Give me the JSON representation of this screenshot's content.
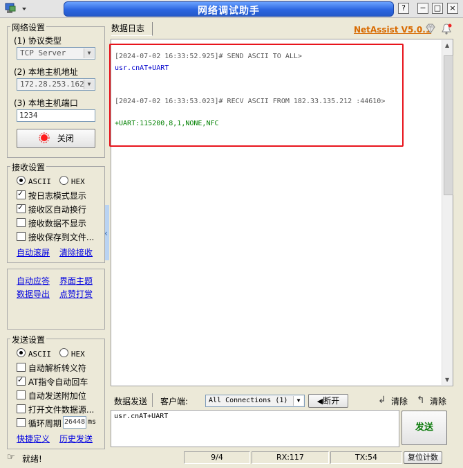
{
  "window": {
    "title": "网络调试助手",
    "menu_icon": "network-app-icon",
    "controls": {
      "help": "?",
      "minimize": "−",
      "maximize": "□",
      "close": "×"
    }
  },
  "network": {
    "group_title": "网络设置",
    "protocol_label": "(1) 协议类型",
    "protocol_value": "TCP Server",
    "host_label": "(2) 本地主机地址",
    "host_value": "172.28.253.162",
    "port_label": "(3) 本地主机端口",
    "port_value": "1234",
    "connect_button": "关闭"
  },
  "receive": {
    "group_title": "接收设置",
    "ascii": "ASCII",
    "hex": "HEX",
    "options": [
      "按日志模式显示",
      "接收区自动换行",
      "接收数据不显示",
      "接收保存到文件..."
    ],
    "options_checked": [
      true,
      true,
      false,
      false
    ],
    "link_scroll": "自动滚屏",
    "link_clear": "清除接收"
  },
  "misc": {
    "auto_reply": "自动应答",
    "theme": "界面主题",
    "export": "数据导出",
    "donate": "点赞打赏"
  },
  "send_settings": {
    "group_title": "发送设置",
    "ascii": "ASCII",
    "hex": "HEX",
    "options": [
      "自动解析转义符",
      "AT指令自动回车",
      "自动发送附加位",
      "打开文件数据源...",
      "循环周期"
    ],
    "options_checked": [
      false,
      true,
      false,
      false,
      false
    ],
    "cycle_value": "26448",
    "cycle_unit": "ms",
    "link_shortcut": "快捷定义",
    "link_history": "历史发送"
  },
  "log": {
    "tab_label": "数据日志",
    "brand": "NetAssist V5.0.1",
    "lines": [
      {
        "text": "[2024-07-02 16:33:52.925]# SEND ASCII TO ALL>",
        "color": "#555555"
      },
      {
        "text": "usr.cnAT+UART",
        "color": "#0000cc"
      },
      {
        "text": "[2024-07-02 16:33:53.023]# RECV ASCII FROM 182.33.135.212 :44610>",
        "color": "#555555"
      },
      {
        "text": "+UART:115200,8,1,NONE,NFC",
        "color": "#008000"
      }
    ]
  },
  "send": {
    "tab_label": "数据发送",
    "client_label": "客户端:",
    "client_value": "All Connections (1)",
    "disconnect": "断开",
    "clear1": "清除",
    "clear2": "清除",
    "text": "usr.cnAT+UART",
    "send_button": "发送"
  },
  "status": {
    "ready": "就绪!",
    "count": "9/4",
    "rx": "RX:117",
    "tx": "TX:54",
    "reset": "复位计数"
  }
}
